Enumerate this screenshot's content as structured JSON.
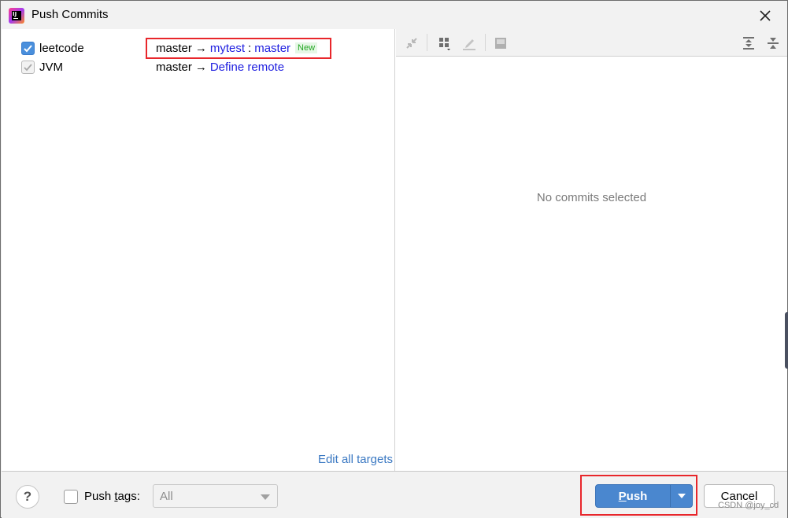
{
  "window": {
    "title": "Push Commits",
    "icon": "intellij-idea-icon",
    "close_icon": "close-icon"
  },
  "repos": [
    {
      "name": "leetcode",
      "checked": true,
      "enabled": true,
      "source_branch": "master",
      "arrow": "→",
      "remote": "mytest",
      "separator": ":",
      "target_branch": "master",
      "badge": "New"
    },
    {
      "name": "JVM",
      "checked": true,
      "enabled": false,
      "source_branch": "master",
      "arrow": "→",
      "remote_link": "Define remote"
    }
  ],
  "left_pane": {
    "edit_all_targets": "Edit all targets"
  },
  "toolbar": {
    "icons": [
      "collapse-icon",
      "group-by-icon",
      "edit-icon",
      "preview-icon",
      "expand-all-icon",
      "collapse-all-icon"
    ]
  },
  "right_pane": {
    "empty_text": "No commits selected"
  },
  "footer": {
    "help_label": "?",
    "push_tags_label_pre": "Push ",
    "push_tags_mnemonic": "t",
    "push_tags_label_post": "ags:",
    "push_tags_checked": false,
    "tags_select_value": "All",
    "push_mnemonic": "P",
    "push_label_rest": "ush",
    "cancel_label": "Cancel",
    "watermark": "CSDN @joy_cd"
  },
  "colors": {
    "accent": "#4a87cf",
    "link": "#2020e0",
    "highlight": "#e8262b",
    "badge_text": "#1fa51f"
  }
}
